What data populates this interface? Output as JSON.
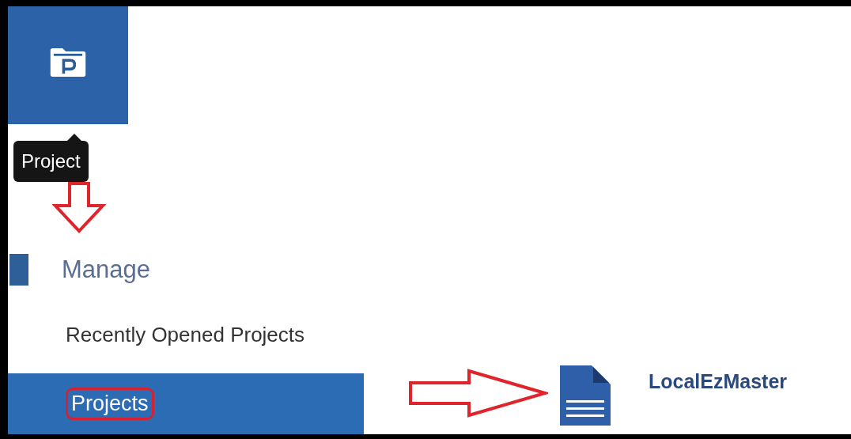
{
  "app_tile": {
    "tooltip": "Project"
  },
  "nav": [
    {
      "kind": "section",
      "label": "Manage"
    },
    {
      "kind": "item",
      "label": "Recently Opened Projects",
      "selected": false
    },
    {
      "kind": "item",
      "label": "Projects",
      "selected": true
    }
  ],
  "projects": [
    {
      "name": "LocalEzMaster"
    }
  ]
}
